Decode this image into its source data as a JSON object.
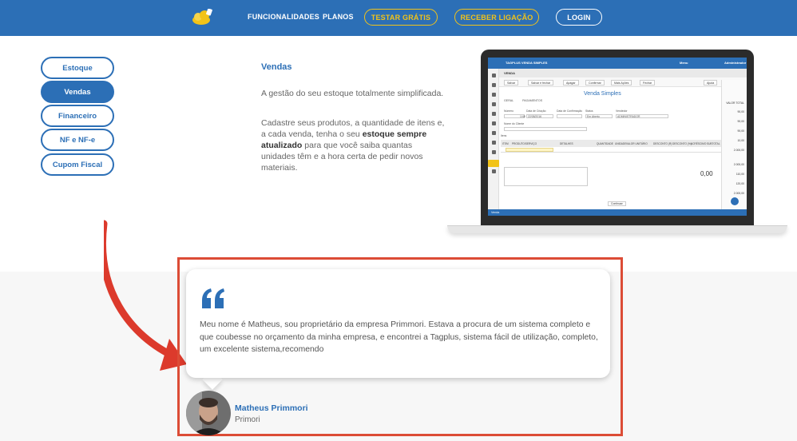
{
  "nav": {
    "links": [
      "FUNCIONALIDADES",
      "PLANOS"
    ],
    "test_label": "TESTAR GRÁTIS",
    "call_label": "RECEBER LIGAÇÃO",
    "login_label": "LOGIN"
  },
  "side_menu": {
    "items": [
      "Estoque",
      "Vendas",
      "Financeiro",
      "NF e NF-e",
      "Cupom Fiscal"
    ],
    "active": "Vendas"
  },
  "feature": {
    "title": "Vendas",
    "intro": "A gestão do seu estoque totalmente simplificada.",
    "body_before": "Cadastre seus produtos, a quantidade de itens e, a cada venda, tenha o seu ",
    "body_bold": "estoque sempre atualizado",
    "body_after": " para que você saiba quantas unidades têm e a hora certa de pedir novos materiais."
  },
  "app_preview": {
    "top_title": "TAGPLUS VENDA SIMPLES",
    "top_menu": "Menu",
    "top_user": "Administrador",
    "section": "VENDA",
    "toolbar": [
      "Salvar",
      "Salvar e fechar",
      "Apagar",
      "Confirmar",
      "Mais Ações",
      "Fechar",
      "Ajuda"
    ],
    "heading": "Venda Simples",
    "tabs": [
      "GERAL",
      "PAGAMENTOS"
    ],
    "labels": [
      "Número",
      "Data de Criação",
      "Data de Confirmação",
      "Status",
      "Vendedor",
      "Nome do Cliente",
      "Itens"
    ],
    "values": [
      "1/48",
      "22/08/2016",
      "Em Aberto",
      "ADMINISTRADOR"
    ],
    "grid_headers": [
      "ITEM",
      "PRODUTO/SERVIÇO",
      "DETALHES",
      "QUANTIDADE",
      "UNIDADE",
      "VALOR UNITÁRIO",
      "DESCONTO (R)",
      "DESCONTO (%)",
      "ACRÉSCIMO",
      "SUBTOTAL"
    ],
    "total_value": "0,00",
    "right_values": [
      "VALOR TOTAL",
      "90,00",
      "90,00",
      "90,00",
      "10,00",
      "2.000,00",
      "2.000,00",
      "110,00",
      "120,00",
      "2.000,00"
    ],
    "continue_label": "Continuar",
    "bottom_tab": "Venda"
  },
  "testimonial": {
    "quote": "Meu nome é Matheus, sou proprietário da empresa Primmori. Estava a procura de um sistema completo e que coubesse no orçamento da minha empresa, e encontrei a Tagplus, sistema fácil de utilização, completo, um excelente sistema,recomendo",
    "name": "Matheus Primmori",
    "company": "Primori"
  },
  "colors": {
    "brand_blue": "#2c6fb6",
    "accent_yellow": "#f2c318",
    "highlight_red": "#dc4c36"
  },
  "icons": [
    "logo-icon",
    "quote-icon",
    "avatar",
    "arrow-icon"
  ]
}
